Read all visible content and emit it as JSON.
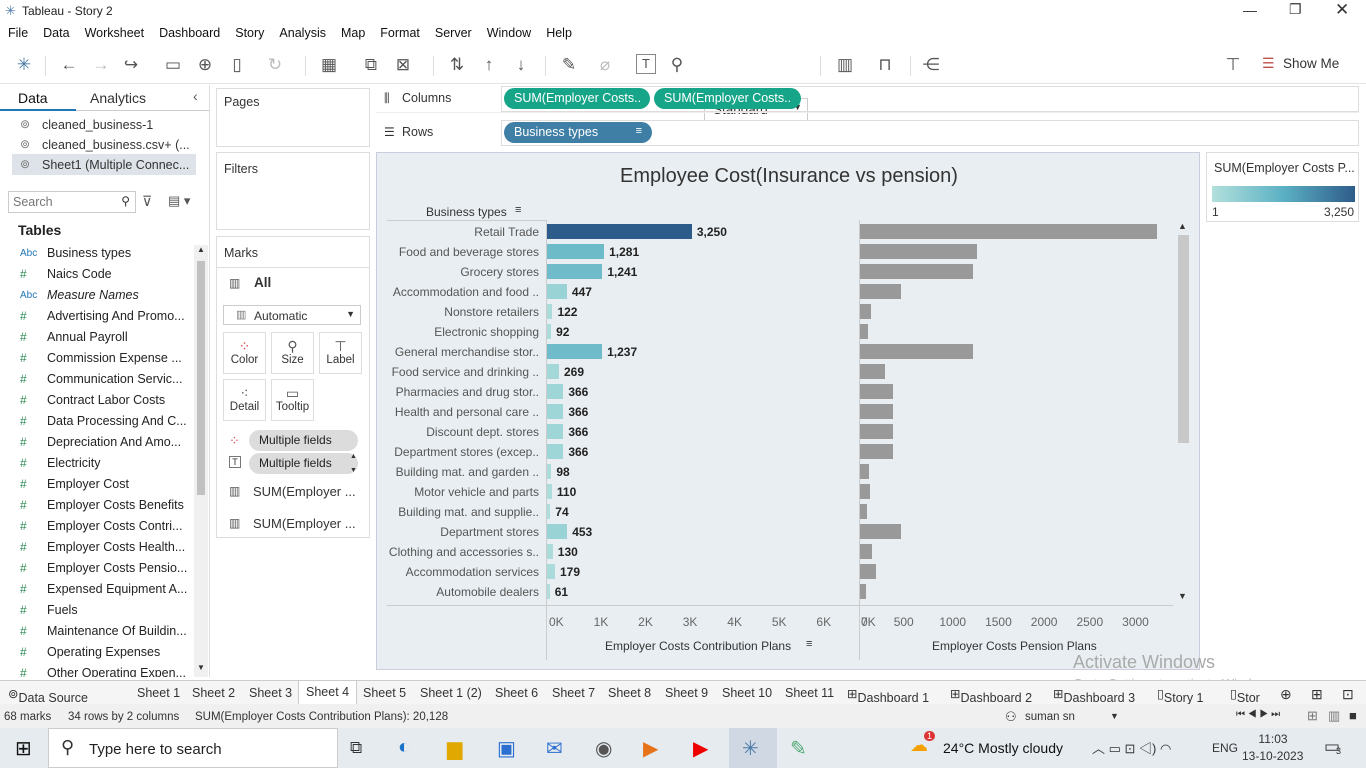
{
  "window": {
    "title": "Tableau - Story 2"
  },
  "menu": [
    "File",
    "Data",
    "Worksheet",
    "Dashboard",
    "Story",
    "Analysis",
    "Map",
    "Format",
    "Server",
    "Window",
    "Help"
  ],
  "toolbar": {
    "fit_value": "Standard",
    "show_me": "Show Me"
  },
  "datapane": {
    "tabs": [
      "Data",
      "Analytics"
    ],
    "sources": [
      "cleaned_business-1",
      "cleaned_business.csv+ (...",
      "Sheet1 (Multiple Connec..."
    ],
    "search_placeholder": "Search",
    "tables_label": "Tables",
    "fields": [
      {
        "icon": "Abc",
        "name": "Business types"
      },
      {
        "icon": "#",
        "name": "Naics Code"
      },
      {
        "icon": "Abc",
        "name": "Measure Names"
      },
      {
        "icon": "#",
        "name": "Advertising And Promo..."
      },
      {
        "icon": "#",
        "name": "Annual Payroll"
      },
      {
        "icon": "#",
        "name": "Commission Expense ..."
      },
      {
        "icon": "#",
        "name": "Communication Servic..."
      },
      {
        "icon": "#",
        "name": "Contract Labor Costs"
      },
      {
        "icon": "#",
        "name": "Data Processing And C..."
      },
      {
        "icon": "#",
        "name": "Depreciation And Amo..."
      },
      {
        "icon": "#",
        "name": "Electricity"
      },
      {
        "icon": "#",
        "name": "Employer Cost"
      },
      {
        "icon": "#",
        "name": "Employer Costs Benefits"
      },
      {
        "icon": "#",
        "name": "Employer Costs Contri..."
      },
      {
        "icon": "#",
        "name": "Employer Costs Health..."
      },
      {
        "icon": "#",
        "name": "Employer Costs Pensio..."
      },
      {
        "icon": "#",
        "name": "Expensed Equipment A..."
      },
      {
        "icon": "#",
        "name": "Fuels"
      },
      {
        "icon": "#",
        "name": "Maintenance Of Buildin..."
      },
      {
        "icon": "#",
        "name": "Operating Expenses"
      },
      {
        "icon": "#",
        "name": "Other Operating Expen..."
      }
    ]
  },
  "cards": {
    "pages": "Pages",
    "filters": "Filters",
    "marks": "Marks",
    "all": "All",
    "mark_type": "Automatic",
    "buttons": [
      "Color",
      "Size",
      "Label",
      "Detail",
      "Tooltip"
    ],
    "pills": [
      "Multiple fields",
      "Multiple fields",
      "SUM(Employer ...",
      "SUM(Employer ..."
    ]
  },
  "shelves": {
    "columns_label": "Columns",
    "rows_label": "Rows",
    "columns": [
      "SUM(Employer Costs..",
      "SUM(Employer Costs.."
    ],
    "rows": [
      "Business types"
    ]
  },
  "legend": {
    "title": "SUM(Employer Costs P...",
    "min": "1",
    "max": "3,250"
  },
  "chart_data": {
    "type": "bar",
    "title": "Employee Cost(Insurance vs pension)",
    "row_header": "Business types",
    "categories": [
      "Retail Trade",
      "Food and beverage stores",
      "Grocery stores",
      "Accommodation and food ..",
      "Nonstore retailers",
      "Electronic shopping",
      "General merchandise stor..",
      "Food service and drinking ..",
      "Pharmacies and drug stor..",
      "Health and personal care ..",
      "Discount dept. stores",
      "Department stores (excep..",
      "Building mat. and garden ..",
      "Motor vehicle and parts",
      "Building mat. and supplie..",
      "Department stores",
      "Clothing and accessories s..",
      "Accommodation services",
      "Automobile dealers"
    ],
    "series": [
      {
        "name": "Employer Costs Contribution Plans",
        "values": [
          3250,
          1281,
          1241,
          447,
          122,
          92,
          1237,
          269,
          366,
          366,
          366,
          366,
          98,
          110,
          74,
          453,
          130,
          179,
          61
        ],
        "labels": [
          "3,250",
          "1,281",
          "1,241",
          "447",
          "122",
          "92",
          "1,237",
          "269",
          "366",
          "366",
          "366",
          "366",
          "98",
          "110",
          "74",
          "453",
          "130",
          "179",
          "61"
        ]
      },
      {
        "name": "Employer Costs Pension Plans",
        "values": [
          3250,
          1281,
          1241,
          447,
          122,
          92,
          1237,
          269,
          366,
          366,
          366,
          366,
          98,
          110,
          74,
          453,
          130,
          179,
          61
        ]
      }
    ],
    "xlabel_left": "Employer Costs Contribution Plans",
    "xlabel_right": "Employer Costs Pension Plans",
    "ticks_left": [
      "0K",
      "1K",
      "2K",
      "3K",
      "4K",
      "5K",
      "6K",
      "7K"
    ],
    "ticks_right": [
      "0",
      "500",
      "1000",
      "1500",
      "2000",
      "2500",
      "3000"
    ],
    "xlim_left": [
      0,
      7000
    ],
    "xlim_right": [
      0,
      3250
    ],
    "colors": {
      "high": "#2e5c8a",
      "mid": "#5bb0c4",
      "low": "#b2e0dc",
      "gray": "#999999"
    }
  },
  "sheet_tabs": [
    "Data Source",
    "Sheet 1",
    "Sheet 2",
    "Sheet 3",
    "Sheet 4",
    "Sheet 5",
    "Sheet 1 (2)",
    "Sheet 6",
    "Sheet 7",
    "Sheet 8",
    "Sheet 9",
    "Sheet 10",
    "Sheet 11",
    "Dashboard 1",
    "Dashboard 2",
    "Dashboard 3",
    "Story 1",
    "Stor"
  ],
  "status": {
    "marks": "68 marks",
    "dims": "34 rows by 2 columns",
    "sum": "SUM(Employer Costs Contribution Plans): 20,128",
    "user": "suman sn"
  },
  "watermark": {
    "line1": "Activate Windows",
    "line2": "Go to Settings to activate Windows."
  },
  "taskbar": {
    "search": "Type here to search",
    "weather": "24°C  Mostly cloudy",
    "lang": "ENG",
    "time": "11:03",
    "date": "13-10-2023",
    "badge": "1",
    "notif": "3"
  }
}
